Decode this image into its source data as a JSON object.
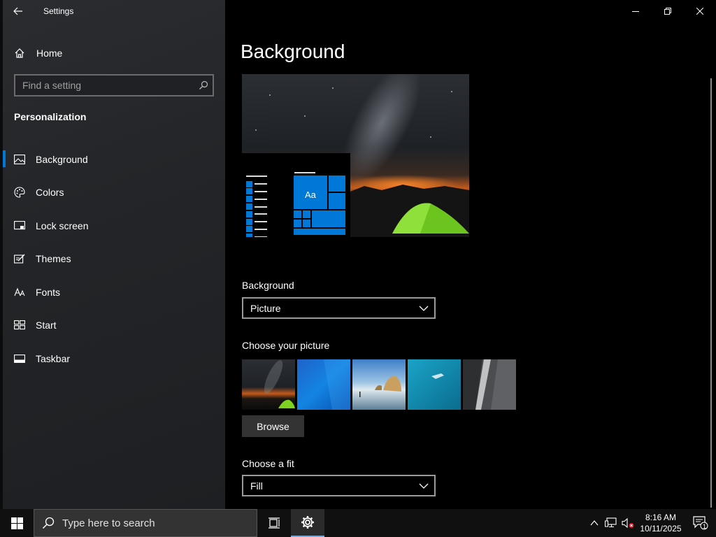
{
  "window": {
    "title": "Settings",
    "back_icon": "arrow-left-icon"
  },
  "sidebar": {
    "home_label": "Home",
    "search_placeholder": "Find a setting",
    "section_title": "Personalization",
    "items": [
      {
        "label": "Background",
        "icon": "picture-icon",
        "active": true
      },
      {
        "label": "Colors",
        "icon": "palette-icon",
        "active": false
      },
      {
        "label": "Lock screen",
        "icon": "lock-screen-icon",
        "active": false
      },
      {
        "label": "Themes",
        "icon": "themes-icon",
        "active": false
      },
      {
        "label": "Fonts",
        "icon": "fonts-icon",
        "active": false
      },
      {
        "label": "Start",
        "icon": "start-icon",
        "active": false
      },
      {
        "label": "Taskbar",
        "icon": "taskbar-icon",
        "active": false
      }
    ]
  },
  "main": {
    "page_title": "Background",
    "preview_tile_text": "Aa",
    "background_label": "Background",
    "background_value": "Picture",
    "choose_picture_label": "Choose your picture",
    "browse_label": "Browse",
    "fit_label": "Choose a fit",
    "fit_value": "Fill"
  },
  "taskbar": {
    "search_placeholder": "Type here to search",
    "time": "8:16 AM",
    "date": "10/11/2025",
    "notification_count": "1"
  },
  "colors": {
    "accent": "#0078d7",
    "sidebar_bg": "#232528",
    "taskbar_bg": "#101010",
    "tent_green": "#7ed321"
  }
}
